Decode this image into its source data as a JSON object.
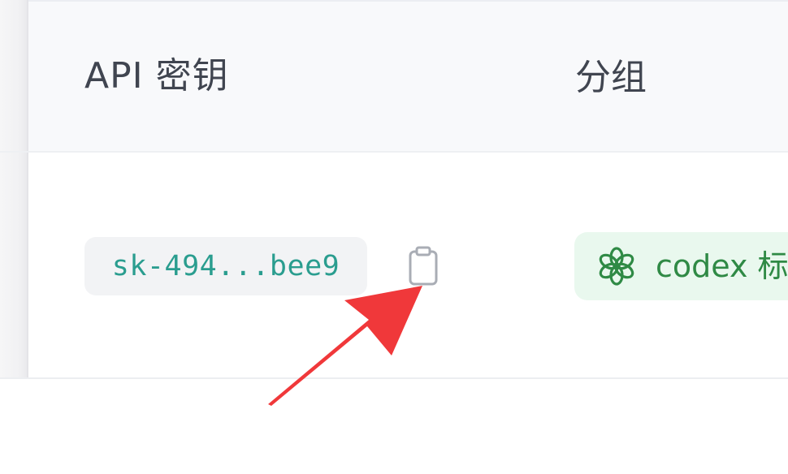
{
  "table": {
    "headers": {
      "api_key": "API 密钥",
      "group": "分组"
    },
    "rows": [
      {
        "api_key": "sk-494...bee9",
        "group_label": "codex 标"
      }
    ]
  },
  "icons": {
    "copy": "clipboard-icon",
    "group": "openai-logo-icon",
    "annotation": "red-arrow-annotation"
  },
  "colors": {
    "key_text": "#2a9d8f",
    "key_chip_bg": "#f2f3f5",
    "group_text": "#2f8a45",
    "group_bg": "#e9f8ee",
    "arrow": "#f0383a",
    "header_bg": "#f8f9fb",
    "header_text": "#404550"
  }
}
